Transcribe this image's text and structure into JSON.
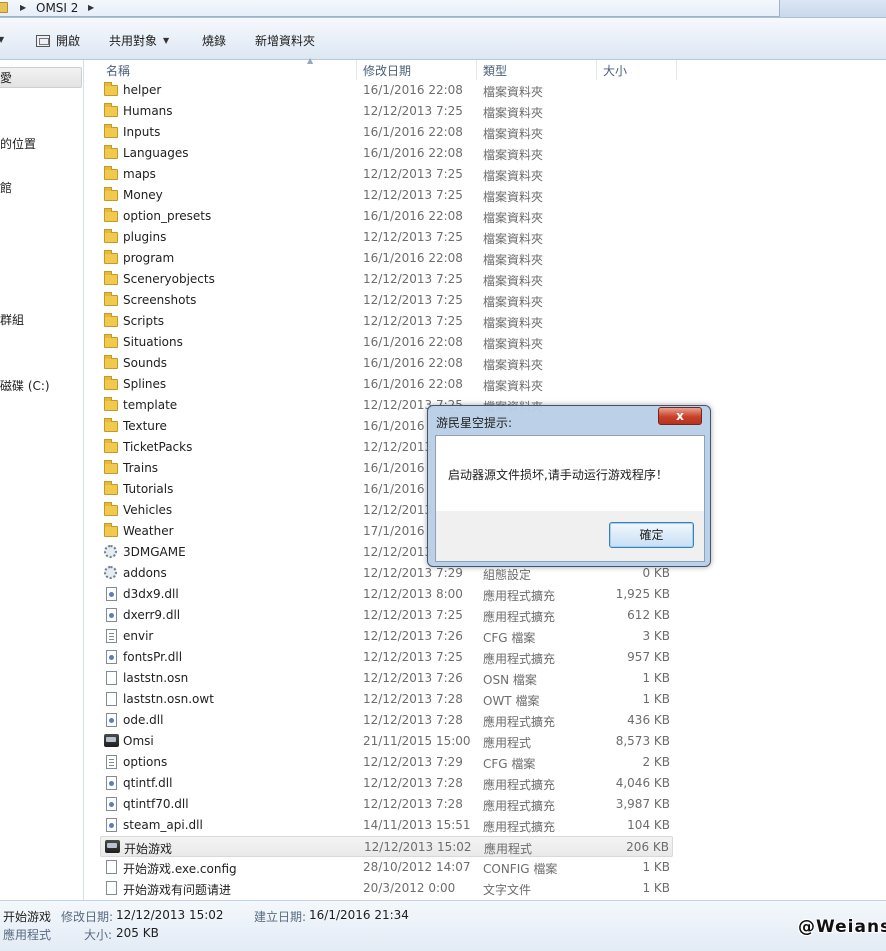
{
  "address": {
    "path": "OMSI 2"
  },
  "toolbar": {
    "open": "開啟",
    "share": "共用對象",
    "burn": "燒錄",
    "new_folder": "新增資料夾"
  },
  "nav": {
    "items": [
      {
        "label": "愛"
      },
      {
        "label": "的位置"
      },
      {
        "label": "館"
      },
      {
        "label": "群組"
      },
      {
        "label": "磁碟 (C:)"
      }
    ]
  },
  "columns": {
    "name": "名稱",
    "date": "修改日期",
    "type": "類型",
    "size": "大小"
  },
  "files": [
    {
      "name": "helper",
      "date": "16/1/2016 22:08",
      "type": "檔案資料夾",
      "size": "",
      "icon": "folder-icon"
    },
    {
      "name": "Humans",
      "date": "12/12/2013 7:25",
      "type": "檔案資料夾",
      "size": "",
      "icon": "folder-icon"
    },
    {
      "name": "Inputs",
      "date": "16/1/2016 22:08",
      "type": "檔案資料夾",
      "size": "",
      "icon": "folder-icon"
    },
    {
      "name": "Languages",
      "date": "16/1/2016 22:08",
      "type": "檔案資料夾",
      "size": "",
      "icon": "folder-icon"
    },
    {
      "name": "maps",
      "date": "12/12/2013 7:25",
      "type": "檔案資料夾",
      "size": "",
      "icon": "folder-icon"
    },
    {
      "name": "Money",
      "date": "12/12/2013 7:25",
      "type": "檔案資料夾",
      "size": "",
      "icon": "folder-icon"
    },
    {
      "name": "option_presets",
      "date": "16/1/2016 22:08",
      "type": "檔案資料夾",
      "size": "",
      "icon": "folder-icon"
    },
    {
      "name": "plugins",
      "date": "12/12/2013 7:25",
      "type": "檔案資料夾",
      "size": "",
      "icon": "folder-icon"
    },
    {
      "name": "program",
      "date": "16/1/2016 22:08",
      "type": "檔案資料夾",
      "size": "",
      "icon": "folder-icon"
    },
    {
      "name": "Sceneryobjects",
      "date": "12/12/2013 7:25",
      "type": "檔案資料夾",
      "size": "",
      "icon": "folder-icon"
    },
    {
      "name": "Screenshots",
      "date": "12/12/2013 7:25",
      "type": "檔案資料夾",
      "size": "",
      "icon": "folder-icon"
    },
    {
      "name": "Scripts",
      "date": "12/12/2013 7:25",
      "type": "檔案資料夾",
      "size": "",
      "icon": "folder-icon"
    },
    {
      "name": "Situations",
      "date": "16/1/2016 22:08",
      "type": "檔案資料夾",
      "size": "",
      "icon": "folder-icon"
    },
    {
      "name": "Sounds",
      "date": "16/1/2016 22:08",
      "type": "檔案資料夾",
      "size": "",
      "icon": "folder-icon"
    },
    {
      "name": "Splines",
      "date": "16/1/2016 22:08",
      "type": "檔案資料夾",
      "size": "",
      "icon": "folder-icon"
    },
    {
      "name": "template",
      "date": "12/12/2013 7:25",
      "type": "檔案資料夾",
      "size": "",
      "icon": "folder-icon"
    },
    {
      "name": "Texture",
      "date": "16/1/2016",
      "type": "",
      "size": "",
      "icon": "folder-icon"
    },
    {
      "name": "TicketPacks",
      "date": "12/12/2013",
      "type": "",
      "size": "",
      "icon": "folder-icon"
    },
    {
      "name": "Trains",
      "date": "16/1/2016",
      "type": "",
      "size": "",
      "icon": "folder-icon"
    },
    {
      "name": "Tutorials",
      "date": "16/1/2016",
      "type": "",
      "size": "",
      "icon": "folder-icon"
    },
    {
      "name": "Vehicles",
      "date": "12/12/2013",
      "type": "",
      "size": "",
      "icon": "folder-icon"
    },
    {
      "name": "Weather",
      "date": "17/1/2016",
      "type": "",
      "size": "",
      "icon": "folder-icon"
    },
    {
      "name": "3DMGAME",
      "date": "12/12/2013",
      "type": "",
      "size": "",
      "icon": "gear-icon"
    },
    {
      "name": "addons",
      "date": "12/12/2013 7:29",
      "type": "組態設定",
      "size": "0 KB",
      "icon": "gear-icon"
    },
    {
      "name": "d3dx9.dll",
      "date": "12/12/2013 8:00",
      "type": "應用程式擴充",
      "size": "1,925 KB",
      "icon": "dll-icon"
    },
    {
      "name": "dxerr9.dll",
      "date": "12/12/2013 7:25",
      "type": "應用程式擴充",
      "size": "612 KB",
      "icon": "dll-icon"
    },
    {
      "name": "envir",
      "date": "12/12/2013 7:26",
      "type": "CFG 檔案",
      "size": "3 KB",
      "icon": "cfg-icon"
    },
    {
      "name": "fontsPr.dll",
      "date": "12/12/2013 7:25",
      "type": "應用程式擴充",
      "size": "957 KB",
      "icon": "dll-icon"
    },
    {
      "name": "laststn.osn",
      "date": "12/12/2013 7:26",
      "type": "OSN 檔案",
      "size": "1 KB",
      "icon": "file-icon"
    },
    {
      "name": "laststn.osn.owt",
      "date": "12/12/2013 7:28",
      "type": "OWT 檔案",
      "size": "1 KB",
      "icon": "file-icon"
    },
    {
      "name": "ode.dll",
      "date": "12/12/2013 7:28",
      "type": "應用程式擴充",
      "size": "436 KB",
      "icon": "dll-icon"
    },
    {
      "name": "Omsi",
      "date": "21/11/2015 15:00",
      "type": "應用程式",
      "size": "8,573 KB",
      "icon": "exe-icon"
    },
    {
      "name": "options",
      "date": "12/12/2013 7:29",
      "type": "CFG 檔案",
      "size": "2 KB",
      "icon": "cfg-icon"
    },
    {
      "name": "qtintf.dll",
      "date": "12/12/2013 7:28",
      "type": "應用程式擴充",
      "size": "4,046 KB",
      "icon": "dll-icon"
    },
    {
      "name": "qtintf70.dll",
      "date": "12/12/2013 7:28",
      "type": "應用程式擴充",
      "size": "3,987 KB",
      "icon": "dll-icon"
    },
    {
      "name": "steam_api.dll",
      "date": "14/11/2013 15:51",
      "type": "應用程式擴充",
      "size": "104 KB",
      "icon": "dll-icon"
    },
    {
      "name": "开始游戏",
      "date": "12/12/2013 15:02",
      "type": "應用程式",
      "size": "206 KB",
      "icon": "exe-icon",
      "selected": true
    },
    {
      "name": "开始游戏.exe.config",
      "date": "28/10/2012 14:07",
      "type": "CONFIG 檔案",
      "size": "1 KB",
      "icon": "file-icon"
    },
    {
      "name": "开始游戏有问题请进",
      "date": "20/3/2012 0:00",
      "type": "文字文件",
      "size": "1 KB",
      "icon": "file-icon"
    }
  ],
  "dialog": {
    "title": "游民星空提示:",
    "close": "x",
    "message": "启动器源文件损坏,请手动运行游戏程序！",
    "ok": "確定"
  },
  "details": {
    "name": "开始游戏",
    "kind": "應用程式",
    "modified_label": "修改日期:",
    "modified_value": "12/12/2013 15:02",
    "created_label": "建立日期:",
    "created_value": "16/1/2016 21:34",
    "size_label": "大小:",
    "size_value": "205 KB"
  },
  "watermark": "@Weians"
}
